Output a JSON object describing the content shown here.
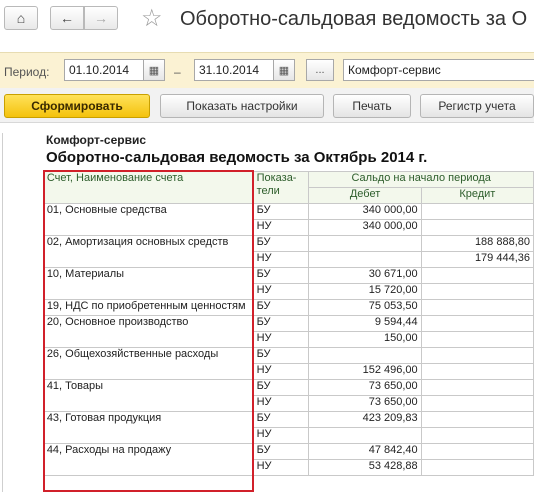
{
  "title_bar": {
    "title": "Оборотно-сальдовая ведомость за О",
    "home_icon": "⌂",
    "back_icon": "←",
    "forward_icon": "→",
    "star_icon": "☆"
  },
  "period_bar": {
    "label": "Период:",
    "date_from": "01.10.2014",
    "dash": "–",
    "date_to": "31.10.2014",
    "more_label": "...",
    "organization": "Комфорт-сервис"
  },
  "toolbar": {
    "form_label": "Сформировать",
    "settings_label": "Показать настройки",
    "print_label": "Печать",
    "register_label": "Регистр учета"
  },
  "report": {
    "org": "Комфорт-сервис",
    "title": "Оборотно-сальдовая ведомость за Октябрь 2014 г.",
    "headers": {
      "account": "Счет, Наименование счета",
      "indicators": "Показа-тели",
      "opening_balance": "Сальдо на начало периода",
      "debit": "Дебет",
      "credit": "Кредит"
    },
    "rows": [
      {
        "account": "01, Основные средства",
        "ind": "БУ",
        "debit": "340 000,00",
        "credit": ""
      },
      {
        "account": "",
        "ind": "НУ",
        "debit": "340 000,00",
        "credit": ""
      },
      {
        "account": "02, Амортизация основных средств",
        "ind": "БУ",
        "debit": "",
        "credit": "188 888,80"
      },
      {
        "account": "",
        "ind": "НУ",
        "debit": "",
        "credit": "179 444,36"
      },
      {
        "account": "10, Материалы",
        "ind": "БУ",
        "debit": "30 671,00",
        "credit": ""
      },
      {
        "account": "",
        "ind": "НУ",
        "debit": "15 720,00",
        "credit": ""
      },
      {
        "account": "19, НДС по приобретенным ценностям",
        "ind": "БУ",
        "debit": "75 053,50",
        "credit": ""
      },
      {
        "account": "20, Основное производство",
        "ind": "БУ",
        "debit": "9 594,44",
        "credit": ""
      },
      {
        "account": "",
        "ind": "НУ",
        "debit": "150,00",
        "credit": ""
      },
      {
        "account": "26, Общехозяйственные расходы",
        "ind": "БУ",
        "debit": "",
        "credit": ""
      },
      {
        "account": "",
        "ind": "НУ",
        "debit": "152 496,00",
        "credit": ""
      },
      {
        "account": "41, Товары",
        "ind": "БУ",
        "debit": "73 650,00",
        "credit": ""
      },
      {
        "account": "",
        "ind": "НУ",
        "debit": "73 650,00",
        "credit": ""
      },
      {
        "account": "43, Готовая продукция",
        "ind": "БУ",
        "debit": "423 209,83",
        "credit": ""
      },
      {
        "account": "",
        "ind": "НУ",
        "debit": "",
        "credit": ""
      },
      {
        "account": "44, Расходы на продажу",
        "ind": "БУ",
        "debit": "47 842,40",
        "credit": ""
      },
      {
        "account": "",
        "ind": "НУ",
        "debit": "53 428,88",
        "credit": ""
      }
    ]
  },
  "colors": {
    "highlight": "#d1202a",
    "header_bg": "#f3f8ec",
    "period_bg": "#fbf2d3",
    "primary_button": "#f4c20d"
  }
}
